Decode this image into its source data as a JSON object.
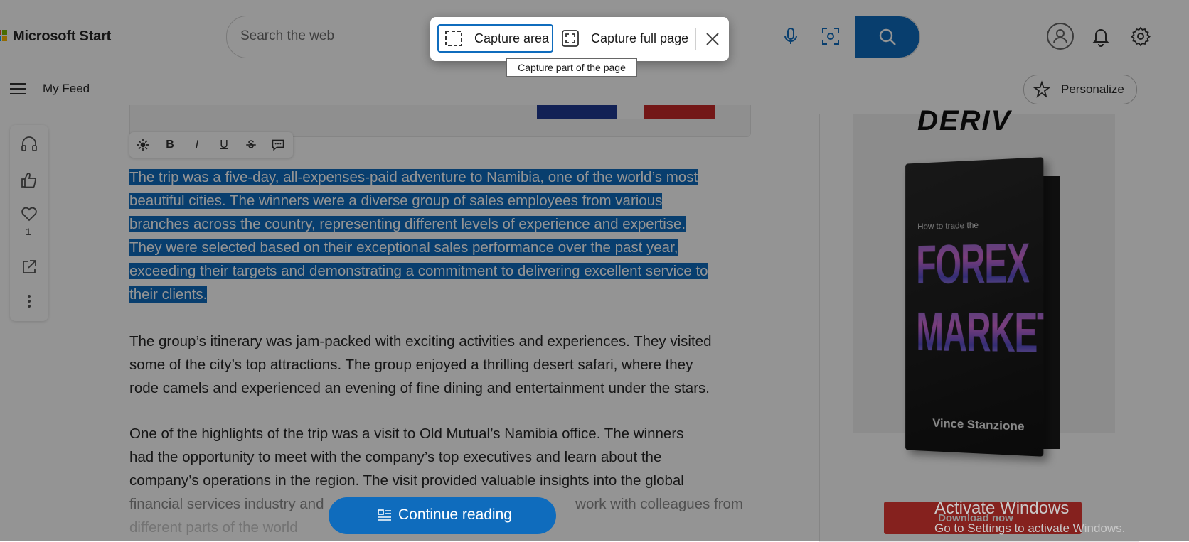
{
  "header": {
    "brand": "Microsoft Start",
    "search_placeholder": "Search the web",
    "icons": [
      "microphone-icon",
      "visual-search-icon",
      "search-icon",
      "profile-icon",
      "bell-icon",
      "gear-icon"
    ]
  },
  "nav": {
    "menu_label": "My Feed",
    "personalize_label": "Personalize"
  },
  "capture": {
    "area_label": "Capture area",
    "full_label": "Capture full page",
    "tooltip": "Capture part of the page"
  },
  "rail": {
    "like_count": "1"
  },
  "format_toolbar": {
    "bold": "B",
    "italic": "I",
    "underline": "U"
  },
  "article": {
    "paragraphs": [
      [
        "The trip was a five-day, all-expenses-paid adventure to Namibia, one of the world’s most",
        "beautiful cities. The winners were a diverse group of sales employees from various",
        "branches across the country, representing different levels of experience and expertise.",
        "They were selected based on their exceptional sales performance over the past year,",
        "exceeding their targets and demonstrating a commitment to delivering excellent service to",
        "their clients."
      ],
      [
        "The group’s itinerary was jam-packed with exciting activities and experiences. They visited",
        "some of the city’s top attractions. The group enjoyed a thrilling desert safari, where they",
        "rode camels and experienced an evening of fine dining and entertainment under the stars."
      ],
      [
        "One of the highlights of the trip was a visit to Old Mutual’s Namibia office. The winners",
        "had the opportunity to meet with the company’s top executives and learn about the",
        "company’s operations in the region. The visit provided valuable insights into the global",
        "financial services industry and",
        "work with colleagues from",
        "different parts of the world"
      ]
    ],
    "continue_label": "Continue reading"
  },
  "ad": {
    "brand": "DERIV",
    "book_subtitle": "How to trade the",
    "book_title_1": "FOREX",
    "book_title_2": "MARKET",
    "book_author": "Vince Stanzione",
    "cta": "Download now"
  },
  "watermark": {
    "title": "Activate Windows",
    "subtitle": "Go to Settings to activate Windows."
  },
  "colors": {
    "accent": "#0f6cbd",
    "ad_cta": "#e53935",
    "overlay": "rgba(0,0,0,0.42)"
  }
}
